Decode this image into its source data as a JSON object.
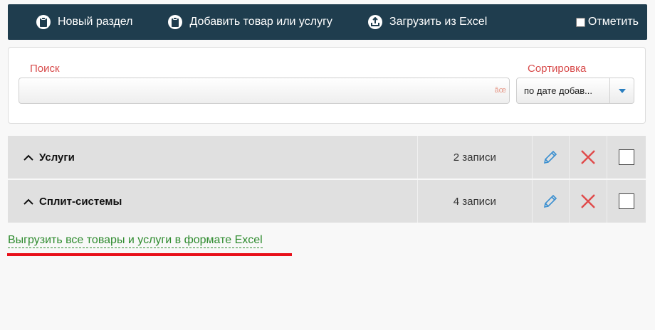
{
  "toolbar": {
    "new_section": "Новый раздел",
    "add_item": "Добавить товар или услугу",
    "import_excel": "Загрузить из Excel",
    "mark_all": "Отметить"
  },
  "search": {
    "label": "Поиск",
    "hint": "âœ",
    "value": ""
  },
  "sort": {
    "label": "Сортировка",
    "selected": "по дате добав..."
  },
  "rows": [
    {
      "name": "Услуги",
      "count": "2 записи"
    },
    {
      "name": "Сплит-системы",
      "count": "4 записи"
    }
  ],
  "export_link": "Выгрузить все товары и услуги в формате Excel",
  "colors": {
    "toolbar_bg": "#1f3d4e",
    "label_red": "#d84c4c",
    "edit_blue": "#3a8fd0",
    "delete_red": "#e04a4a",
    "link_green": "#2e8b2e",
    "highlight_red": "#e8101a"
  },
  "icons": {
    "toolbar": [
      "clipboard-icon",
      "clipboard-icon",
      "upload-icon"
    ],
    "row": [
      "chevron-up-icon",
      "pencil-icon",
      "close-icon",
      "checkbox"
    ]
  }
}
